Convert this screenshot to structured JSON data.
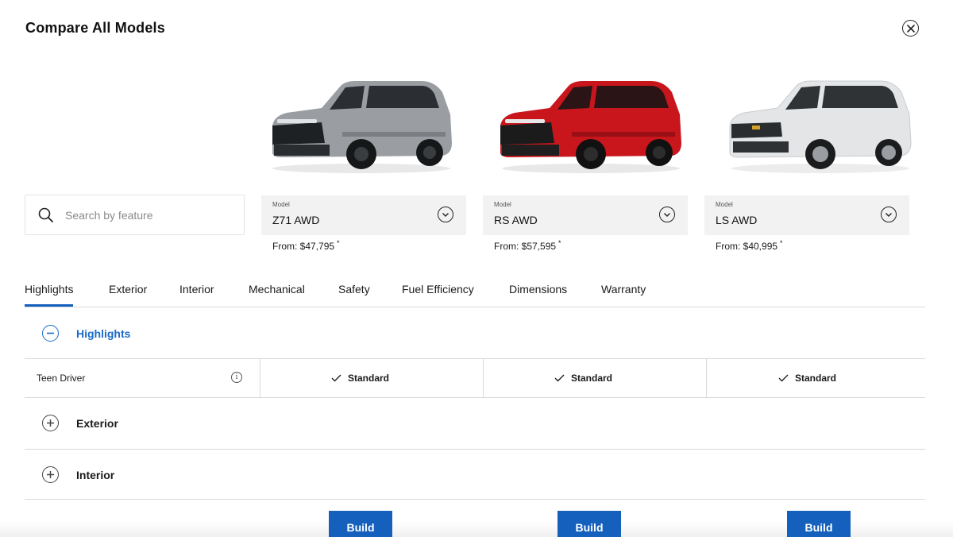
{
  "header": {
    "title": "Compare All Models",
    "close_icon": "close-circle-icon"
  },
  "search": {
    "placeholder": "Search by feature",
    "value": ""
  },
  "models": [
    {
      "caption": "Model",
      "name": "Z71 AWD",
      "price": "From: $47,795",
      "price_mark": "*",
      "color": "#9a9ea2"
    },
    {
      "caption": "Model",
      "name": "RS AWD",
      "price": "From: $57,595",
      "price_mark": "*",
      "color": "#c8161c"
    },
    {
      "caption": "Model",
      "name": "LS AWD",
      "price": "From: $40,995",
      "price_mark": "*",
      "color": "#e6e8ea"
    }
  ],
  "tabs": [
    {
      "label": "Highlights",
      "active": true
    },
    {
      "label": "Exterior"
    },
    {
      "label": "Interior"
    },
    {
      "label": "Mechanical"
    },
    {
      "label": "Safety"
    },
    {
      "label": "Fuel Efficiency"
    },
    {
      "label": "Dimensions"
    },
    {
      "label": "Warranty"
    }
  ],
  "sections": {
    "highlights": {
      "label": "Highlights",
      "expanded": true
    },
    "exterior": {
      "label": "Exterior",
      "expanded": false
    },
    "interior": {
      "label": "Interior",
      "expanded": false
    }
  },
  "features": [
    {
      "name": "Teen Driver",
      "values": [
        "Standard",
        "Standard",
        "Standard"
      ]
    }
  ],
  "build": {
    "label": "Build"
  },
  "colors": {
    "accent": "#1560bd",
    "link": "#1a6bc9",
    "select_bg": "#f2f2f2"
  }
}
